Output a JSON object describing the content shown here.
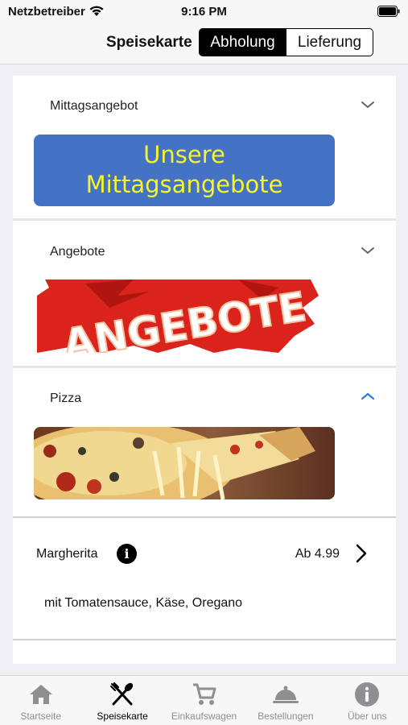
{
  "status_bar": {
    "carrier": "Netzbetreiber",
    "time": "9:16 PM"
  },
  "nav": {
    "title": "Speisekarte",
    "segments": [
      {
        "label": "Abholung",
        "active": true
      },
      {
        "label": "Lieferung",
        "active": false
      }
    ]
  },
  "sections": [
    {
      "title": "Mittagsangebot",
      "expanded": false,
      "banner_text_line1": "Unsere",
      "banner_text_line2": "Mittagsangebote"
    },
    {
      "title": "Angebote",
      "expanded": false,
      "banner_text": "ANGEBOTE"
    },
    {
      "title": "Pizza",
      "expanded": true
    }
  ],
  "items": [
    {
      "name": "Margherita",
      "price": "Ab 4.99",
      "description": "mit Tomatensauce, Käse, Oregano"
    }
  ],
  "tabbar": {
    "tabs": [
      {
        "label": "Startseite",
        "icon": "home-icon",
        "active": false
      },
      {
        "label": "Speisekarte",
        "icon": "fork-knife-icon",
        "active": true
      },
      {
        "label": "Einkaufswagen",
        "icon": "cart-icon",
        "active": false
      },
      {
        "label": "Bestellungen",
        "icon": "cloche-icon",
        "active": false
      },
      {
        "label": "Über uns",
        "icon": "info-icon",
        "active": false
      }
    ]
  },
  "colors": {
    "accent": "#2f7fe0",
    "banner_blue": "#4472c4",
    "banner_text": "#f5f52d",
    "inactive_tab": "#8e8e93"
  }
}
